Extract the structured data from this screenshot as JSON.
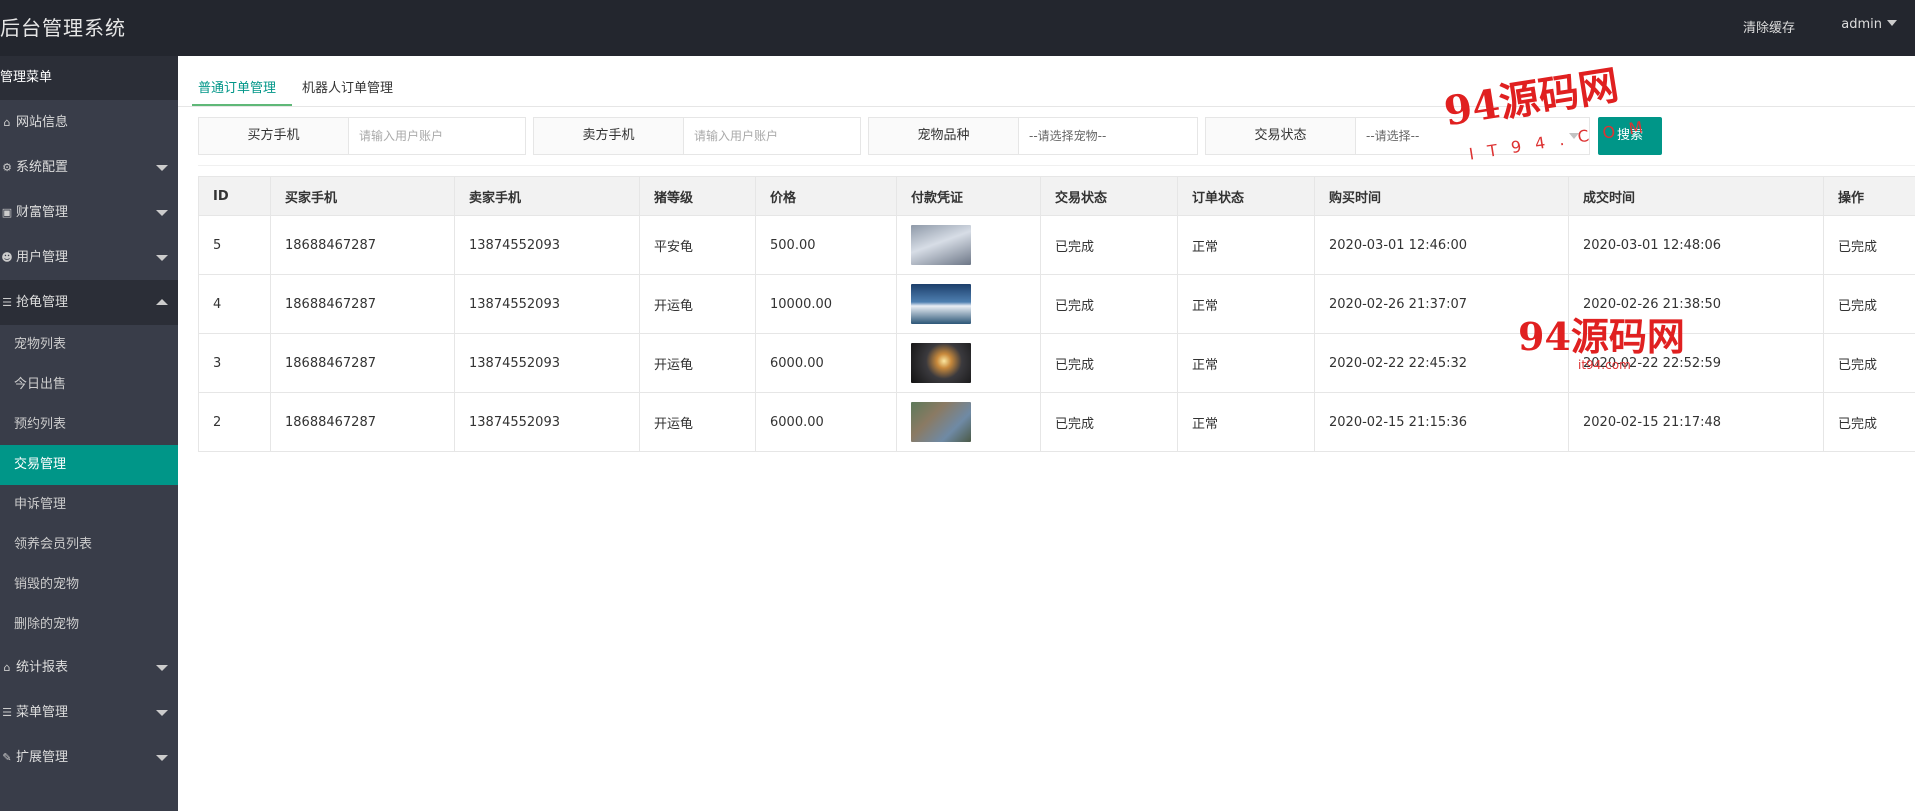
{
  "header": {
    "app_title": "后台管理系统",
    "clear_cache": "清除缓存",
    "user": "admin"
  },
  "sidebar": {
    "heading": "管理菜单",
    "items": [
      {
        "label": "网站信息",
        "icon": "home-icon"
      },
      {
        "label": "系统配置",
        "icon": "cogs-icon"
      },
      {
        "label": "财富管理",
        "icon": "money-icon"
      },
      {
        "label": "用户管理",
        "icon": "users-icon"
      },
      {
        "label": "抢龟管理",
        "icon": "list-icon"
      }
    ],
    "sub_items": [
      "宠物列表",
      "今日出售",
      "预约列表",
      "交易管理",
      "申诉管理",
      "领养会员列表",
      "销毁的宠物",
      "删除的宠物"
    ],
    "active_sub": "交易管理",
    "bottom_items": [
      {
        "label": "统计报表",
        "icon": "home-icon"
      },
      {
        "label": "菜单管理",
        "icon": "list-icon"
      },
      {
        "label": "扩展管理",
        "icon": "wrench-icon"
      }
    ]
  },
  "tabs": {
    "normal": "普通订单管理",
    "robot": "机器人订单管理"
  },
  "filters": {
    "buyer_label": "买方手机",
    "buyer_placeholder": "请输入用户账户",
    "seller_label": "卖方手机",
    "seller_placeholder": "请输入用户账户",
    "pet_label": "宠物品种",
    "pet_select": "--请选择宠物--",
    "status_label": "交易状态",
    "status_select": "--请选择--",
    "search": "搜索"
  },
  "table": {
    "columns": [
      "ID",
      "买家手机",
      "卖家手机",
      "猪等级",
      "价格",
      "付款凭证",
      "交易状态",
      "订单状态",
      "购买时间",
      "成交时间",
      "操作"
    ],
    "rows": [
      {
        "id": "5",
        "buyer": "18688467287",
        "seller": "13874552093",
        "level": "平安龟",
        "price": "500.00",
        "proof": "t1",
        "trade_status": "已完成",
        "order_status": "正常",
        "buy_time": "2020-03-01 12:46:00",
        "deal_time": "2020-03-01 12:48:06",
        "action": "已完成"
      },
      {
        "id": "4",
        "buyer": "18688467287",
        "seller": "13874552093",
        "level": "开运龟",
        "price": "10000.00",
        "proof": "t2",
        "trade_status": "已完成",
        "order_status": "正常",
        "buy_time": "2020-02-26 21:37:07",
        "deal_time": "2020-02-26 21:38:50",
        "action": "已完成"
      },
      {
        "id": "3",
        "buyer": "18688467287",
        "seller": "13874552093",
        "level": "开运龟",
        "price": "6000.00",
        "proof": "t3",
        "trade_status": "已完成",
        "order_status": "正常",
        "buy_time": "2020-02-22 22:45:32",
        "deal_time": "2020-02-22 22:52:59",
        "action": "已完成"
      },
      {
        "id": "2",
        "buyer": "18688467287",
        "seller": "13874552093",
        "level": "开运龟",
        "price": "6000.00",
        "proof": "t4",
        "trade_status": "已完成",
        "order_status": "正常",
        "buy_time": "2020-02-15 21:15:36",
        "deal_time": "2020-02-15 21:17:48",
        "action": "已完成"
      }
    ]
  },
  "watermark": {
    "text": "94源码网",
    "sub": "IT94.COM",
    "sub2": "it94.com"
  },
  "colors": {
    "accent": "#009688",
    "header_bg": "#23262e",
    "sidebar_bg": "#393d49"
  }
}
